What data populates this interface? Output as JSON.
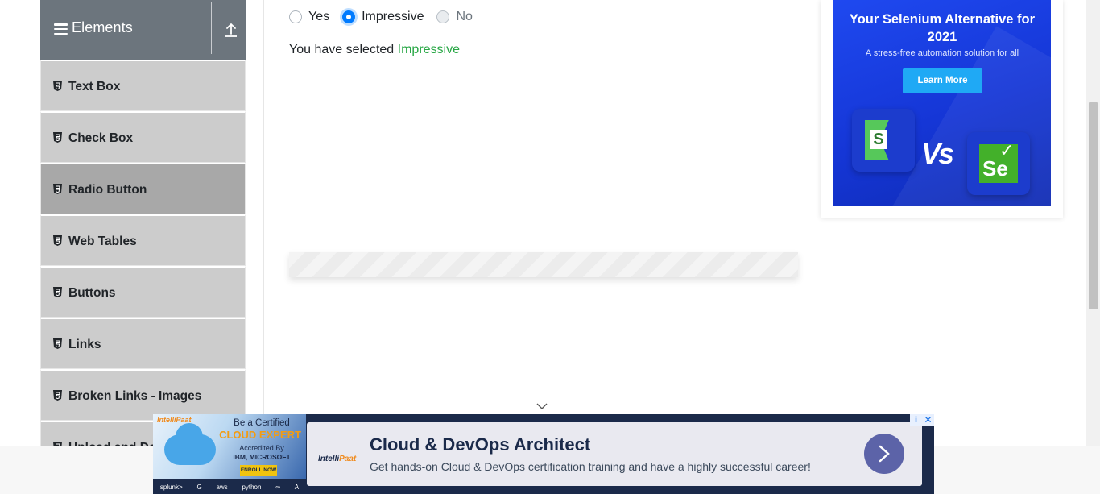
{
  "sidebar": {
    "group_title": "Elements",
    "items": [
      {
        "label": "Text Box"
      },
      {
        "label": "Check Box"
      },
      {
        "label": "Radio Button"
      },
      {
        "label": "Web Tables"
      },
      {
        "label": "Buttons"
      },
      {
        "label": "Links"
      },
      {
        "label": "Broken Links - Images"
      },
      {
        "label": "Upload and Download"
      }
    ],
    "active_item": "Radio Button"
  },
  "radio_group": {
    "options": [
      {
        "label": "Yes",
        "state": "unchecked"
      },
      {
        "label": "Impressive",
        "state": "checked"
      },
      {
        "label": "No",
        "state": "disabled"
      }
    ]
  },
  "result": {
    "prefix": "You have selected",
    "value": "Impressive",
    "value_color": "#28a745"
  },
  "right_ad": {
    "headline": "Your Selenium Alternative for 2021",
    "subline": "A stress-free automation solution for all",
    "cta": "Learn More",
    "vs_text": "Vs",
    "left_logo_letter": "S",
    "right_logo_text": "Se"
  },
  "bottom_ad": {
    "brand_small": "IntelliPaat",
    "cert_line1": "Be a Certified",
    "cert_line2": "CLOUD EXPERT",
    "cert_line3": "Accredited By",
    "cert_line4": "IBM, MICROSOFT",
    "enroll": "ENROLL NOW",
    "partners": [
      "splunk>",
      "G",
      "aws",
      "python",
      "∞",
      "A"
    ],
    "card_logo_prefix": "Intelli",
    "card_logo_suffix": "Paat",
    "title": "Cloud & DevOps Architect",
    "description": "Get hands-on Cloud & DevOps certification training and have a highly successful career!",
    "info_glyph": "i",
    "close_glyph": "✕"
  },
  "colors": {
    "sidebar_header": "#6c757d",
    "menu_item": "#cccccc",
    "menu_item_active": "#a8a8a8",
    "radio_checked": "#007bff",
    "ad_blue": "#1f49f0"
  }
}
